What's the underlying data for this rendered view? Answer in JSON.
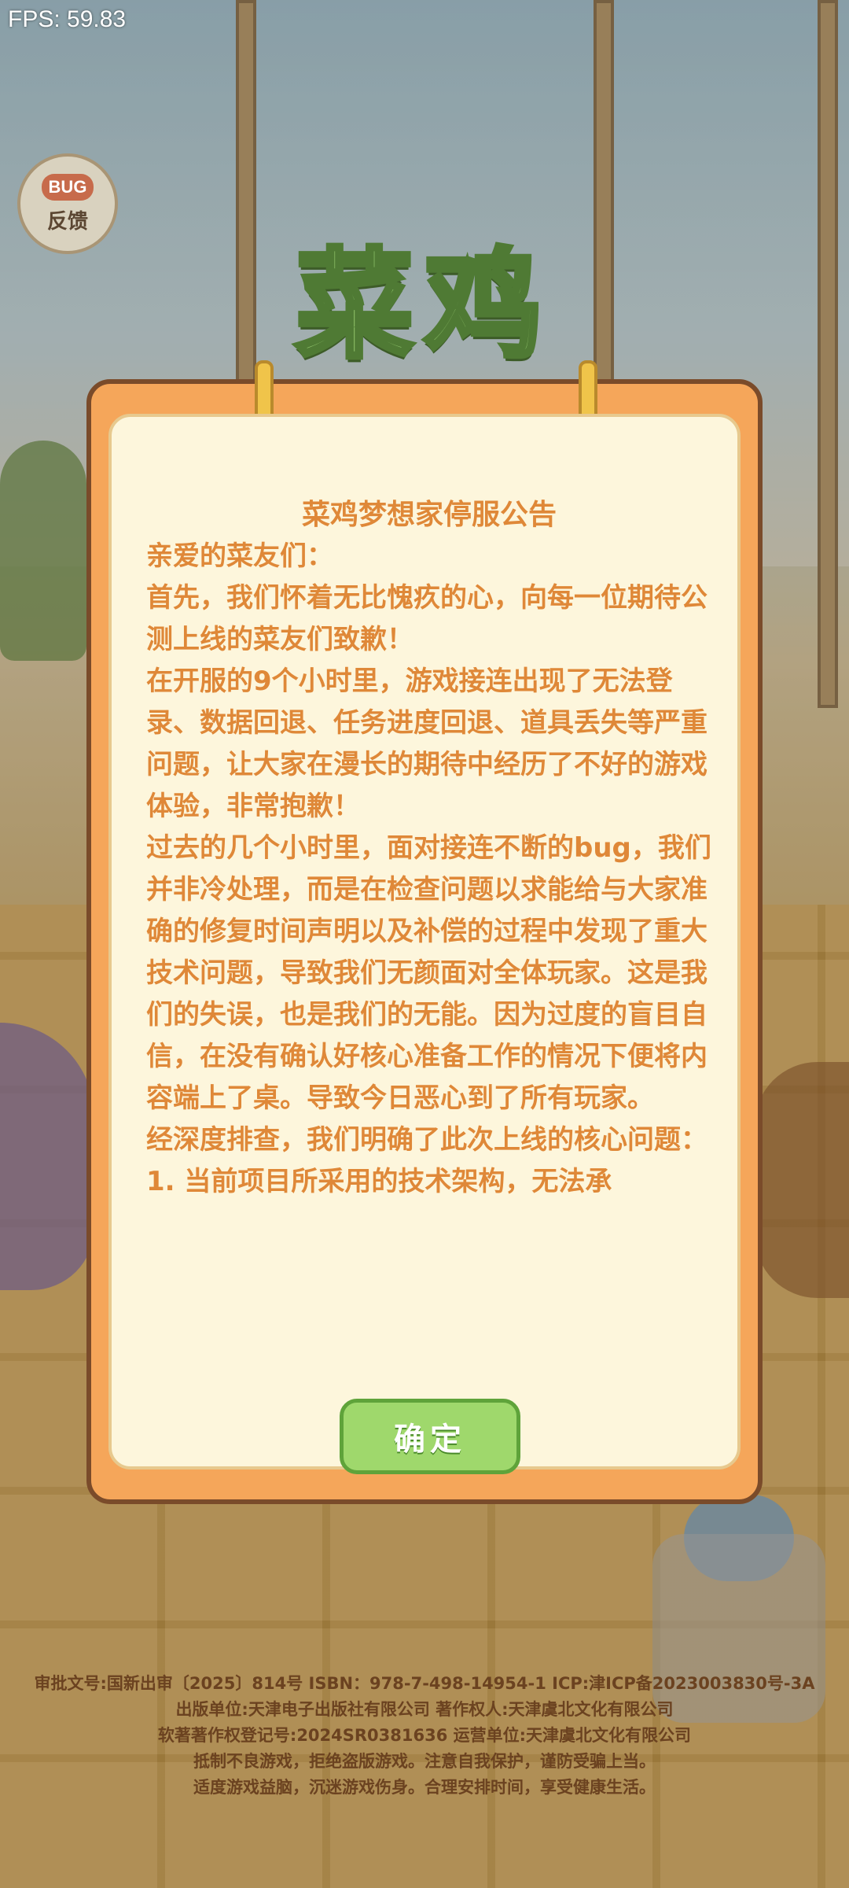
{
  "fps": "FPS: 59.83",
  "feedback": {
    "badge": "BUG",
    "label": "反馈"
  },
  "logo": {
    "text": "菜鸡"
  },
  "notice": {
    "title": "菜鸡梦想家停服公告",
    "paragraphs": [
      "亲爱的菜友们：",
      "首先，我们怀着无比愧疚的心，向每一位期待公测上线的菜友们致歉！",
      "在开服的9个小时里，游戏接连出现了无法登录、数据回退、任务进度回退、道具丢失等严重问题，让大家在漫长的期待中经历了不好的游戏体验，非常抱歉！",
      "过去的几个小时里，面对接连不断的bug，我们并非冷处理，而是在检查问题以求能给与大家准确的修复时间声明以及补偿的过程中发现了重大技术问题，导致我们无颜面对全体玩家。这是我们的失误，也是我们的无能。因为过度的盲目自信，在没有确认好核心准备工作的情况下便将内容端上了桌。导致今日恶心到了所有玩家。",
      "经深度排查，我们明确了此次上线的核心问题：",
      "1. 当前项目所采用的技术架构，无法承"
    ],
    "confirm_label": "确定"
  },
  "legal": [
    "审批文号:国新出审〔2025〕814号   ISBN：978-7-498-14954-1  ICP:津ICP备2023003830号-3A",
    "出版单位:天津电子出版社有限公司   著作权人:天津虞北文化有限公司",
    "软著著作权登记号:2024SR0381636   运营单位:天津虞北文化有限公司",
    "抵制不良游戏，拒绝盗版游戏。注意自我保护，谨防受骗上当。",
    "适度游戏益脑，沉迷游戏伤身。合理安排时间，享受健康生活。"
  ]
}
